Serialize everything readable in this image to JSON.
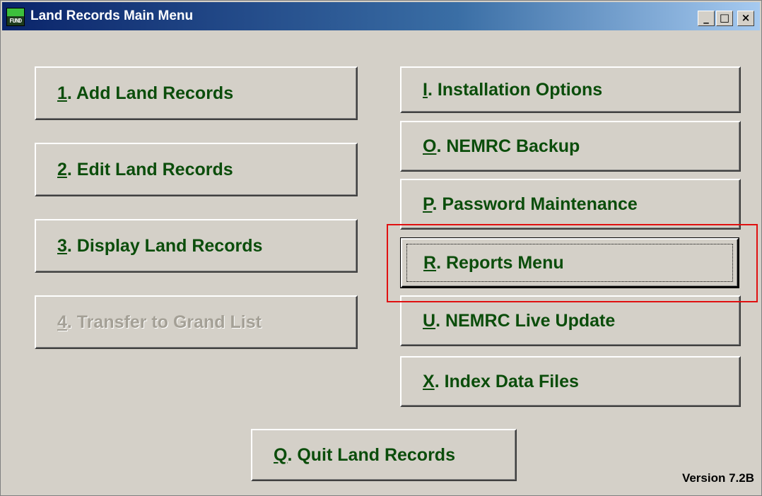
{
  "window": {
    "title": "Land Records Main Menu",
    "icon_label": "FUND",
    "minimize_symbol": "_",
    "maximize_symbol": "□",
    "close_symbol": "×"
  },
  "left_buttons": [
    {
      "key": "1",
      "rest": ".  Add Land Records",
      "enabled": true
    },
    {
      "key": "2",
      "rest": ". Edit Land Records",
      "enabled": true
    },
    {
      "key": "3",
      "rest": ". Display Land Records",
      "enabled": true
    },
    {
      "key": "4",
      "rest": ". Transfer to Grand List",
      "enabled": false
    }
  ],
  "right_buttons": [
    {
      "key": "I",
      "rest": ".  Installation Options"
    },
    {
      "key": "O",
      "rest": ". NEMRC Backup"
    },
    {
      "key": "P",
      "rest": ". Password Maintenance"
    },
    {
      "key": "R",
      "rest": ". Reports Menu",
      "focused": true
    },
    {
      "key": "U",
      "rest": ". NEMRC Live Update"
    },
    {
      "key": "X",
      "rest": ".  Index Data Files"
    }
  ],
  "quit_button": {
    "key": "Q",
    "rest": ". Quit Land Records"
  },
  "version": "Version 7.2B",
  "colors": {
    "button_text": "#0b4d0b",
    "disabled_text": "#a4a096",
    "highlight": "#e01010",
    "titlebar_start": "#0a246a"
  }
}
